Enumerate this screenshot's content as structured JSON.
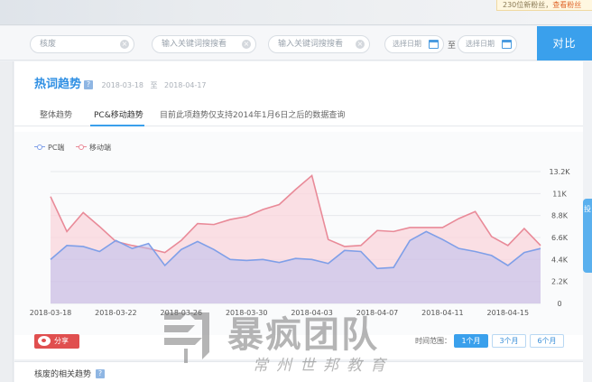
{
  "promo": {
    "text": "230位新粉丝，",
    "link": "查看粉丝"
  },
  "search": {
    "keyword1": "核废",
    "keyword2_placeholder": "输入关键词搜搜看",
    "keyword3_placeholder": "输入关键词搜搜看",
    "start_date_placeholder": "选择日期",
    "to_label": "至",
    "end_date_placeholder": "选择日期",
    "compare_button": "对比"
  },
  "trend": {
    "title": "热词趋势",
    "help": "?",
    "date_start": "2018-03-18",
    "date_sep": "至",
    "date_end": "2018-04-17",
    "tabs": [
      {
        "label": "整体趋势"
      },
      {
        "label": "PC&移动趋势"
      }
    ],
    "tab_note": "目前此项趋势仅支持2014年1月6日之后的数据查询"
  },
  "legend": [
    {
      "name": "PC端",
      "color": "#7f9fe8"
    },
    {
      "name": "移动端",
      "color": "#e98a98"
    }
  ],
  "chart_data": {
    "type": "area",
    "x": [
      "2018-03-18",
      "2018-03-19",
      "2018-03-20",
      "2018-03-21",
      "2018-03-22",
      "2018-03-23",
      "2018-03-24",
      "2018-03-25",
      "2018-03-26",
      "2018-03-27",
      "2018-03-28",
      "2018-03-29",
      "2018-03-30",
      "2018-03-31",
      "2018-04-01",
      "2018-04-02",
      "2018-04-03",
      "2018-04-04",
      "2018-04-05",
      "2018-04-06",
      "2018-04-07",
      "2018-04-08",
      "2018-04-09",
      "2018-04-10",
      "2018-04-11",
      "2018-04-12",
      "2018-04-13",
      "2018-04-14",
      "2018-04-15",
      "2018-04-16",
      "2018-04-17"
    ],
    "x_tick_labels": [
      "2018-03-18",
      "2018-03-22",
      "2018-03-26",
      "2018-03-30",
      "2018-04-03",
      "2018-04-07",
      "2018-04-11",
      "2018-04-15"
    ],
    "y_ticks": [
      "0",
      "2.2K",
      "4.4K",
      "6.6K",
      "8.8K",
      "11K",
      "13.2K"
    ],
    "ylim": [
      0,
      13200
    ],
    "series": [
      {
        "name": "PC端",
        "values": [
          4400,
          5800,
          5700,
          5200,
          6300,
          5500,
          6000,
          3800,
          5400,
          6200,
          5400,
          4400,
          4300,
          4400,
          4100,
          4500,
          4400,
          4000,
          5300,
          5200,
          3500,
          3600,
          6300,
          7200,
          6400,
          5500,
          5200,
          4800,
          3800,
          5100,
          5500
        ]
      },
      {
        "name": "移动端",
        "values": [
          10700,
          7200,
          9100,
          7700,
          6200,
          5800,
          5500,
          5100,
          6300,
          8000,
          7900,
          8400,
          8700,
          9400,
          9900,
          11400,
          12800,
          6400,
          5700,
          5800,
          7300,
          7200,
          7600,
          7600,
          7600,
          8500,
          9200,
          6700,
          5800,
          7500,
          5800
        ]
      }
    ]
  },
  "share": {
    "label": "分享"
  },
  "range": {
    "label": "时间范围：",
    "options": [
      {
        "label": "1个月",
        "active": true
      },
      {
        "label": "3个月",
        "active": false
      },
      {
        "label": "6个月",
        "active": false
      }
    ]
  },
  "related": {
    "title": "核废的相关趋势",
    "help": "?"
  },
  "right_tab": {
    "label": "投"
  },
  "watermark": {
    "title": "暴疯团队",
    "subtitle": "常州世邦教育"
  }
}
